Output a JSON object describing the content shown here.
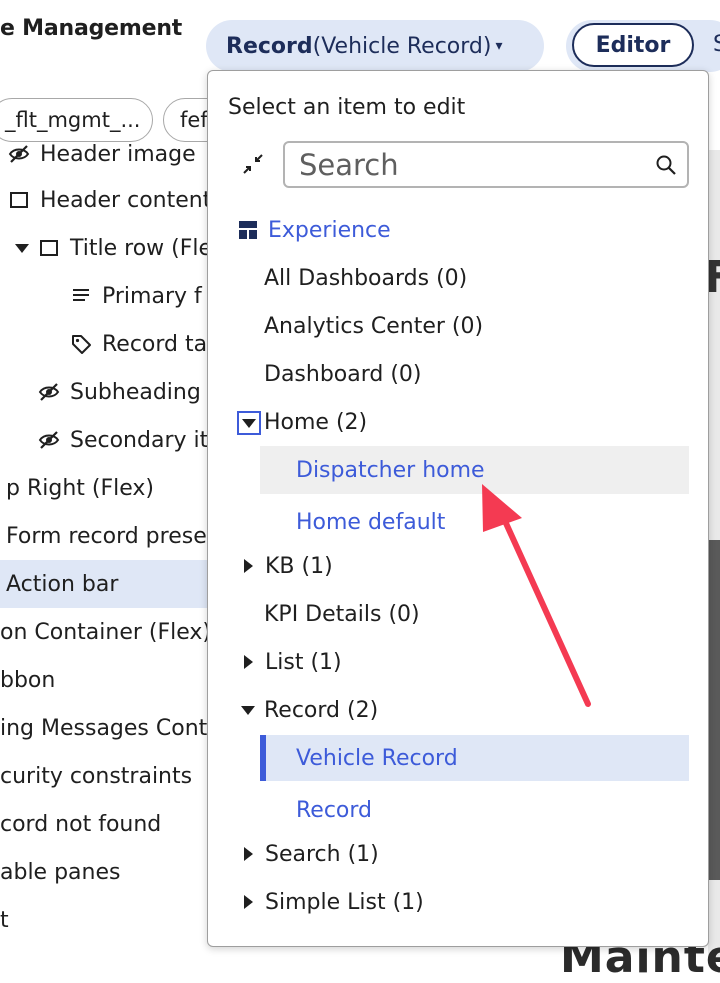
{
  "header": {
    "app_title": "e Management",
    "record_selector": {
      "strong": "Record",
      "rest": " (Vehicle Record)",
      "caret": "▾"
    },
    "editor_label": "Editor",
    "next_pill_text": "S"
  },
  "filters": [
    {
      "label": "_flt_mgmt_..."
    },
    {
      "label": "fef"
    }
  ],
  "tree": [
    {
      "label": "Header image",
      "icon": "eye-slash-icon"
    },
    {
      "label": "Header content",
      "icon": "square-icon"
    },
    {
      "label": "Title row (Fle",
      "icon": "square-icon",
      "caret": "down"
    },
    {
      "label": "Primary f",
      "icon": "text-lines-icon"
    },
    {
      "label": "Record ta",
      "icon": "tag-icon"
    },
    {
      "label": "Subheading",
      "icon": "eye-slash-icon"
    },
    {
      "label": "Secondary it",
      "icon": "eye-slash-icon"
    },
    {
      "label": "p Right (Flex)"
    },
    {
      "label": "Form record prese"
    },
    {
      "label": "Action bar",
      "selected": true
    },
    {
      "label": "on Container (Flex)"
    },
    {
      "label": "bbon"
    },
    {
      "label": "ing Messages Cont"
    },
    {
      "label": "curity constraints"
    },
    {
      "label": "cord not found"
    },
    {
      "label": "able panes"
    },
    {
      "label": "t"
    }
  ],
  "dropdown": {
    "heading": "Select an item to edit",
    "search_placeholder": "Search",
    "section": {
      "label": "Experience",
      "icon": "layout-grid-icon"
    },
    "items": [
      {
        "label": "All Dashboards (0)"
      },
      {
        "label": "Analytics Center (0)"
      },
      {
        "label": "Dashboard (0)"
      },
      {
        "label": "Home (2)",
        "expanded": true,
        "children": [
          {
            "label": "Dispatcher home",
            "highlighted": true
          },
          {
            "label": "Home default"
          }
        ]
      },
      {
        "label": "KB (1)",
        "collapsed": true
      },
      {
        "label": "KPI Details (0)"
      },
      {
        "label": "List (1)",
        "collapsed": true
      },
      {
        "label": "Record (2)",
        "expanded": true,
        "children": [
          {
            "label": "Vehicle Record",
            "selected": true
          },
          {
            "label": "Record"
          }
        ]
      },
      {
        "label": "Search (1)",
        "collapsed": true
      },
      {
        "label": "Simple List (1)",
        "collapsed": true
      }
    ]
  },
  "background": {
    "side_letter": "F",
    "bottom_text": "Mainte"
  },
  "colors": {
    "accent": "#3d5bd9",
    "pill_bg": "#dfe7f6",
    "navy": "#1d2d5a",
    "highlight_bg": "#efefef",
    "annotation_arrow": "#f43a52"
  }
}
